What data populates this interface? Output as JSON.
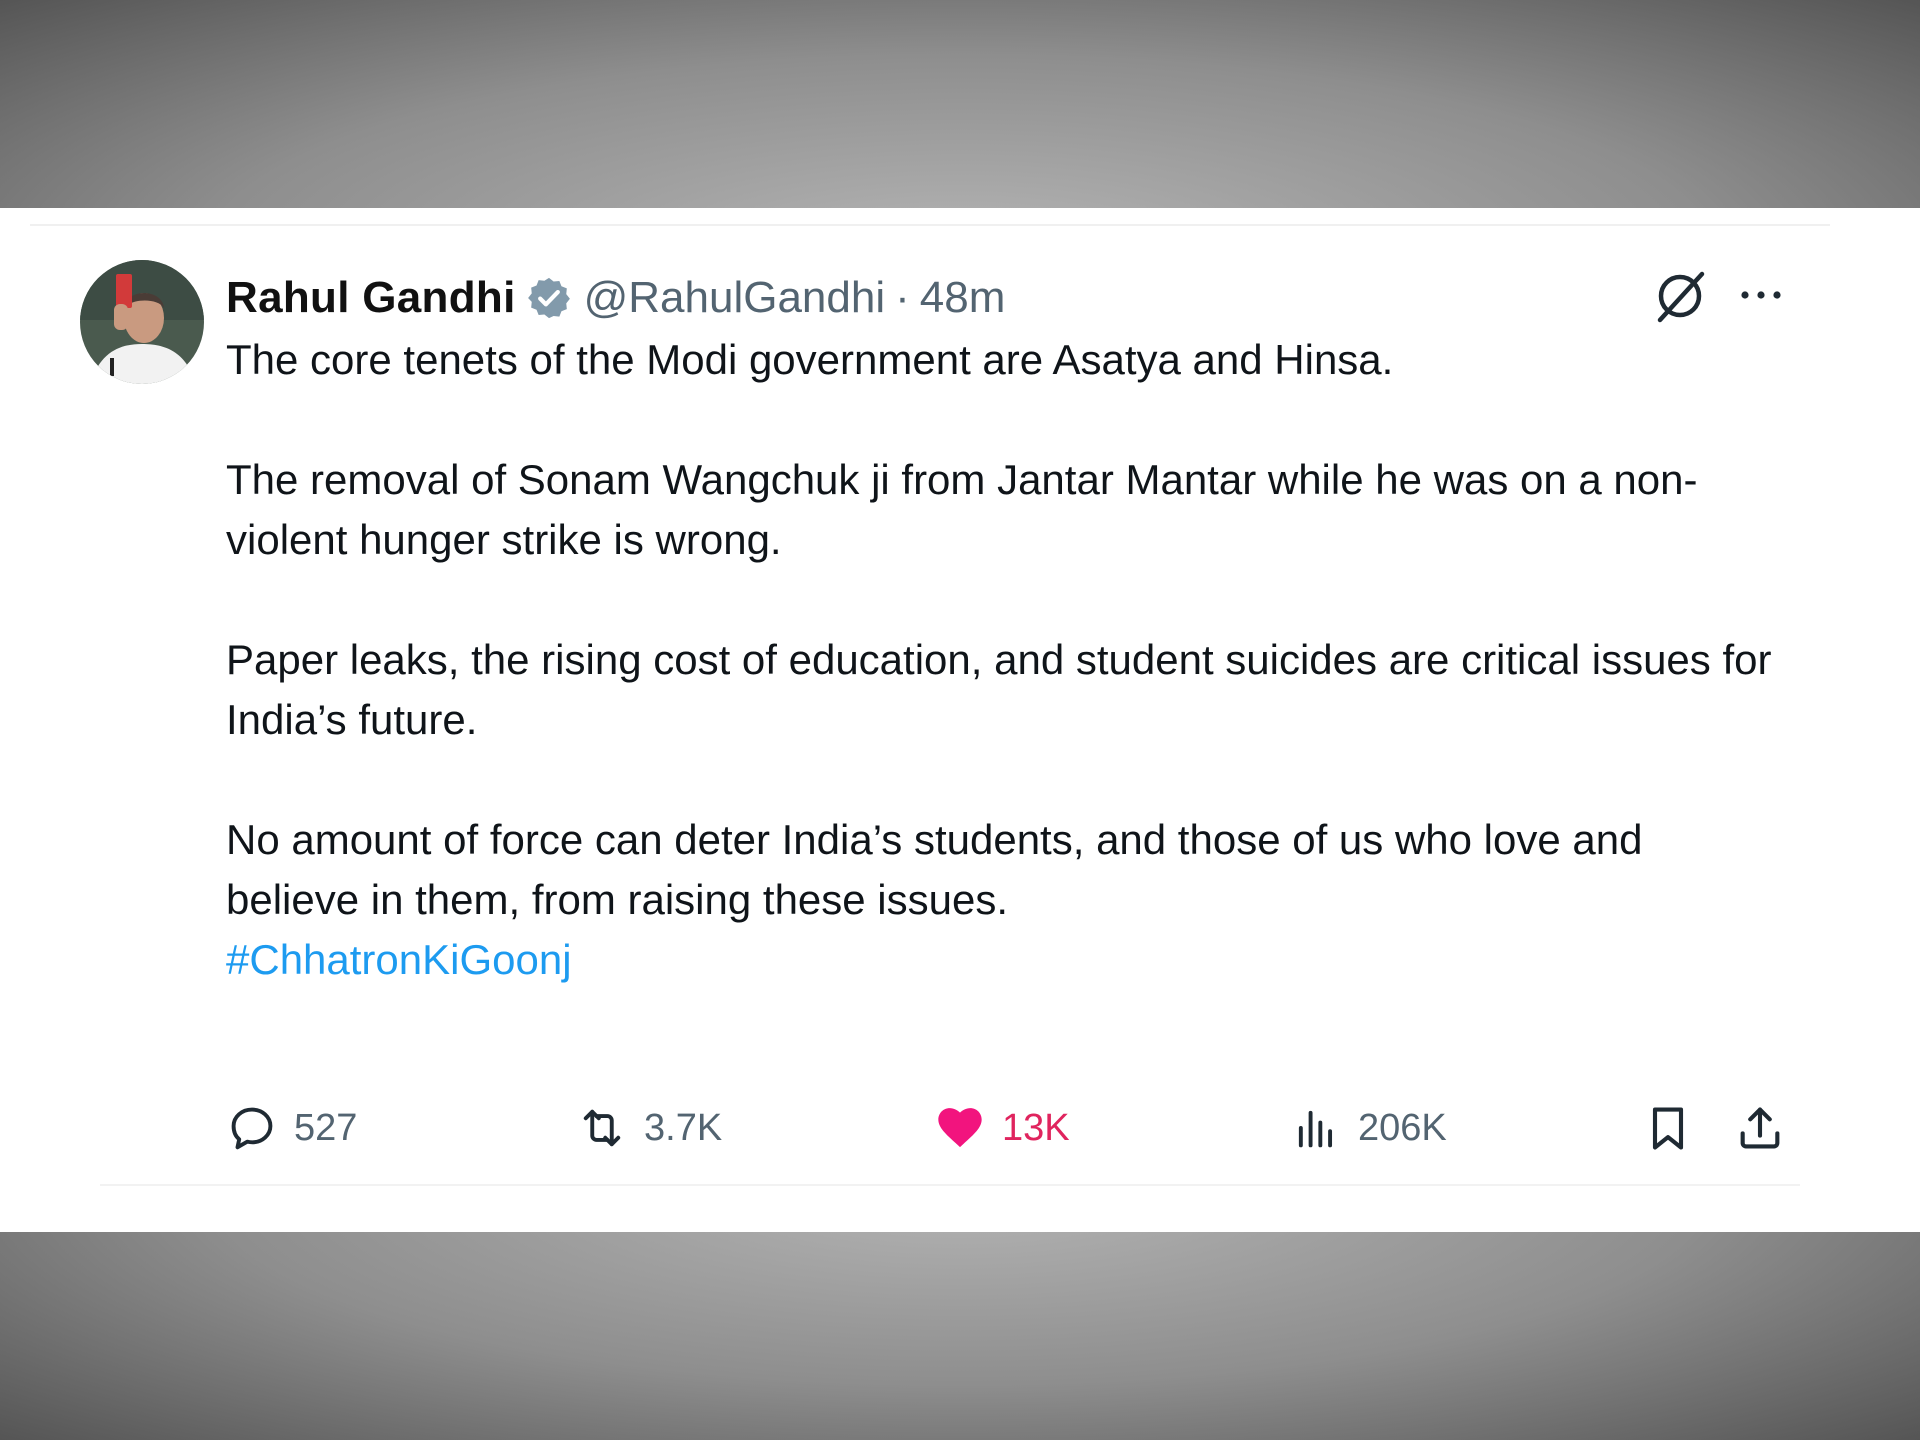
{
  "tweet": {
    "author_name": "Rahul Gandhi",
    "handle": "@RahulGandhi",
    "separator": "·",
    "time": "48m",
    "paragraphs": [
      "The core tenets of the Modi government are Asatya and Hinsa.",
      "The removal of Sonam Wangchuk ji from Jantar Mantar while he was on a non-violent hunger strike is wrong.",
      "Paper leaks, the rising cost of education, and student suicides are critical issues for India’s future.",
      "No amount of force can deter India’s students, and those of us who love and believe in them, from raising these issues."
    ],
    "hashtag": "#ChhatronKiGoonj"
  },
  "actions": {
    "replies": "527",
    "reposts": "3.7K",
    "likes": "13K",
    "views": "206K"
  },
  "icons": {
    "verified": "verified-badge-icon",
    "grok": "grok-icon",
    "more": "more-options-icon",
    "reply": "reply-icon",
    "repost": "repost-icon",
    "like": "heart-icon",
    "views": "views-icon",
    "bookmark": "bookmark-icon",
    "share": "share-icon"
  },
  "colors": {
    "link": "#1d9bf0",
    "like": "#e0245e",
    "muted": "#536471",
    "verified_badge": "#829aab"
  }
}
